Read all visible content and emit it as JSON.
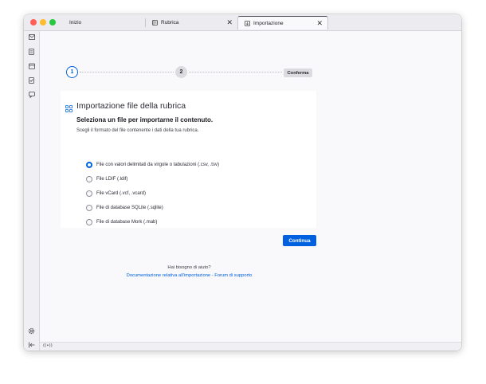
{
  "tabs": [
    {
      "label": "Inizio",
      "icon": "thunderbird-icon",
      "active": false
    },
    {
      "label": "Rubrica",
      "icon": "address-book-icon",
      "active": false,
      "close": "✕"
    },
    {
      "label": "Importazione",
      "icon": "import-icon",
      "active": true,
      "close": "✕"
    }
  ],
  "sidebar": {
    "top_items": [
      "mail-icon",
      "address-book-icon",
      "calendar-icon",
      "tasks-icon",
      "chat-icon"
    ],
    "bottom_items": [
      "settings-icon",
      "collapse-icon"
    ]
  },
  "steps": {
    "step1": "1",
    "step2": "2",
    "step3": "Conferma"
  },
  "card": {
    "title": "Importazione file della rubrica",
    "subtitle": "Seleziona un file per importarne il contenuto.",
    "description": "Scegli il formato del file contenente i dati della tua rubrica.",
    "options": [
      {
        "label": "File con valori delimitati da virgole o tabulazioni (.csv, .tsv)",
        "checked": true
      },
      {
        "label": "File LDIF (.ldif)",
        "checked": false
      },
      {
        "label": "File vCard (.vcf, .vcard)",
        "checked": false
      },
      {
        "label": "File di database SQLite (.sqlite)",
        "checked": false
      },
      {
        "label": "File di database Mork (.mab)",
        "checked": false
      }
    ]
  },
  "continue_label": "Continua",
  "help": {
    "question": "Hai bisogno di aiuto?",
    "links": "Documentazione relativa all'importazione - Forum di supporto"
  },
  "statusbar": {
    "icon": "connection-icon",
    "text": "((•))"
  },
  "colors": {
    "accent": "#0061e0",
    "close": "#ff5f57",
    "minimize": "#febc2e",
    "zoom": "#28c840"
  }
}
